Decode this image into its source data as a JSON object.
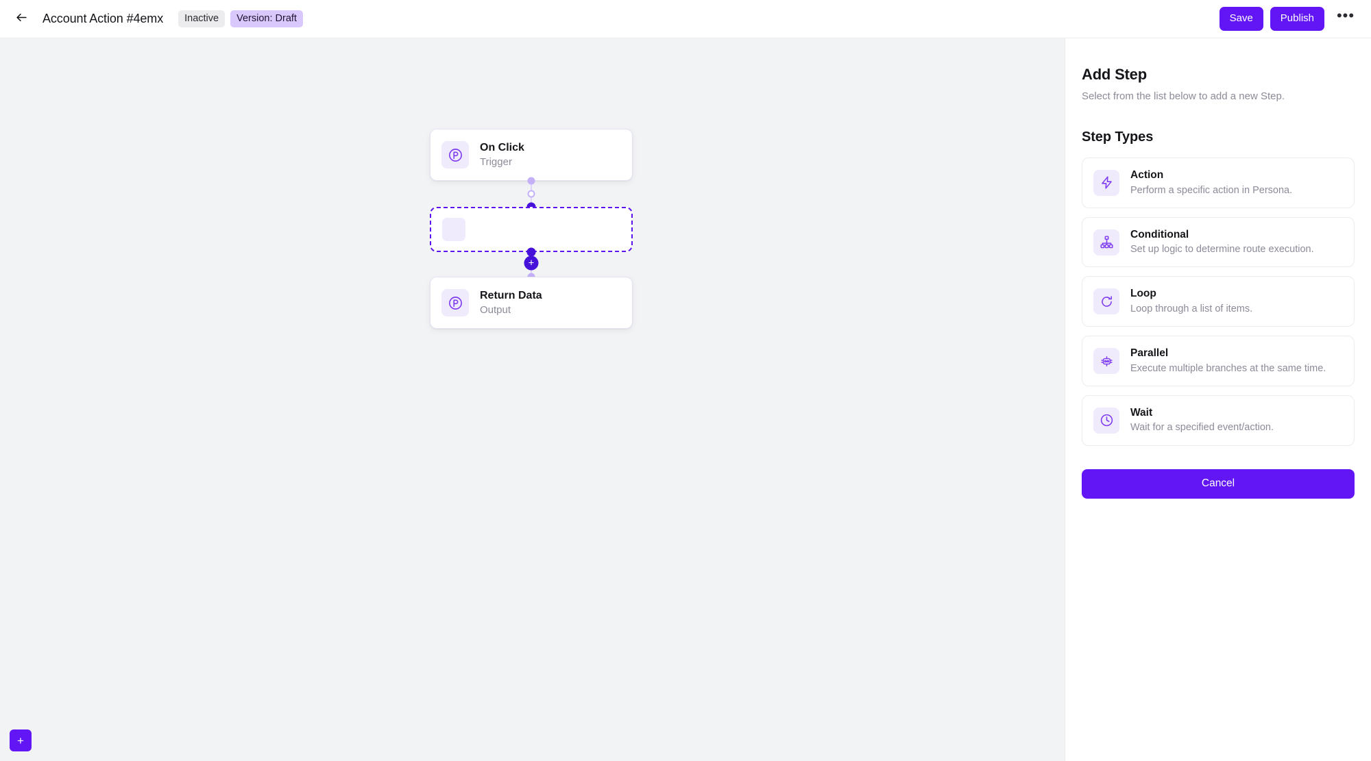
{
  "header": {
    "back_icon": "arrow-left-icon",
    "title": "Account Action #4emx",
    "badges": [
      {
        "label": "Inactive",
        "kind": "neutral"
      },
      {
        "label": "Version: Draft",
        "kind": "accent"
      }
    ],
    "save_label": "Save",
    "publish_label": "Publish",
    "menu_icon": "ellipsis-icon",
    "menu_label": "•••"
  },
  "canvas": {
    "background_color": "#f2f3f5",
    "add_button_label": "+",
    "connector_plus_label": "+",
    "nodes": [
      {
        "title": "On Click",
        "subtitle": "Trigger",
        "icon": "persona-p-icon"
      },
      {
        "title": "",
        "subtitle": "",
        "icon": "empty-placeholder-icon",
        "placeholder": true
      },
      {
        "title": "Return Data",
        "subtitle": "Output",
        "icon": "persona-p-icon"
      }
    ]
  },
  "panel": {
    "title": "Add Step",
    "subtitle": "Select from the list below to add a new Step.",
    "section_title": "Step Types",
    "steps": [
      {
        "label": "Action",
        "description": "Perform a specific action in Persona.",
        "icon": "lightning-bolt-icon"
      },
      {
        "label": "Conditional",
        "description": "Set up logic to determine route execution.",
        "icon": "sitemap-icon"
      },
      {
        "label": "Loop",
        "description": "Loop through a list of items.",
        "icon": "refresh-loop-icon"
      },
      {
        "label": "Parallel",
        "description": "Execute multiple branches at the same time.",
        "icon": "parallel-branches-icon"
      },
      {
        "label": "Wait",
        "description": "Wait for a specified event/action.",
        "icon": "clock-icon"
      }
    ],
    "cancel_label": "Cancel"
  },
  "colors": {
    "accent": "#6316f5",
    "accent_dark": "#4612d9",
    "accent_soft": "#f0eafd",
    "badge_accent_bg": "#d9c8fb",
    "canvas_bg": "#f2f3f5"
  }
}
